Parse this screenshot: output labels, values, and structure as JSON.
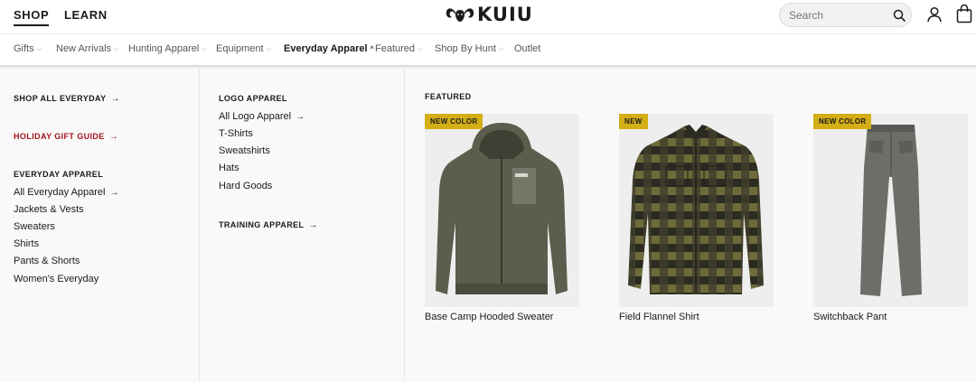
{
  "header": {
    "tabs": {
      "shop": "SHOP",
      "learn": "LEARN"
    },
    "logo_text": "KUIU",
    "search_placeholder": "Search"
  },
  "nav": {
    "items": [
      {
        "label": "Gifts",
        "has_dropdown": true
      },
      {
        "label": "New Arrivals",
        "has_dropdown": true
      },
      {
        "label": "Hunting Apparel",
        "has_dropdown": true
      },
      {
        "label": "Equipment",
        "has_dropdown": true
      },
      {
        "label": "Everyday Apparel",
        "has_dropdown": true,
        "active": true
      },
      {
        "label": "Featured",
        "has_dropdown": true
      },
      {
        "label": "Shop By Hunt",
        "has_dropdown": true
      },
      {
        "label": "Outlet",
        "has_dropdown": false
      }
    ],
    "chevron_down": "⌵",
    "chevron_up": "^"
  },
  "menu": {
    "col1": {
      "shop_all": "SHOP ALL EVERYDAY",
      "holiday": "HOLIDAY GIFT GUIDE",
      "section_heading": "EVERYDAY APPAREL",
      "links": [
        "All Everyday Apparel",
        "Jackets & Vests",
        "Sweaters",
        "Shirts",
        "Pants & Shorts",
        "Women's Everyday"
      ]
    },
    "col2": {
      "section_heading": "LOGO APPAREL",
      "links": [
        "All Logo Apparel",
        "T-Shirts",
        "Sweatshirts",
        "Hats",
        "Hard Goods"
      ],
      "training": "TRAINING APPAREL"
    },
    "featured": {
      "heading": "FEATURED",
      "cards": [
        {
          "badge": "NEW COLOR",
          "title": "Base Camp Hooded Sweater"
        },
        {
          "badge": "NEW",
          "title": "Field Flannel Shirt"
        },
        {
          "badge": "NEW COLOR",
          "title": "Switchback Pant"
        }
      ]
    },
    "arrow": "→"
  },
  "colors": {
    "accent_red": "#a3161c",
    "badge_yellow": "#d4ae17",
    "sweater": "#5c5d4c",
    "flannel_olive": "#6f6a3a",
    "flannel_dark": "#2c2b22",
    "pant": "#6b6f68"
  }
}
